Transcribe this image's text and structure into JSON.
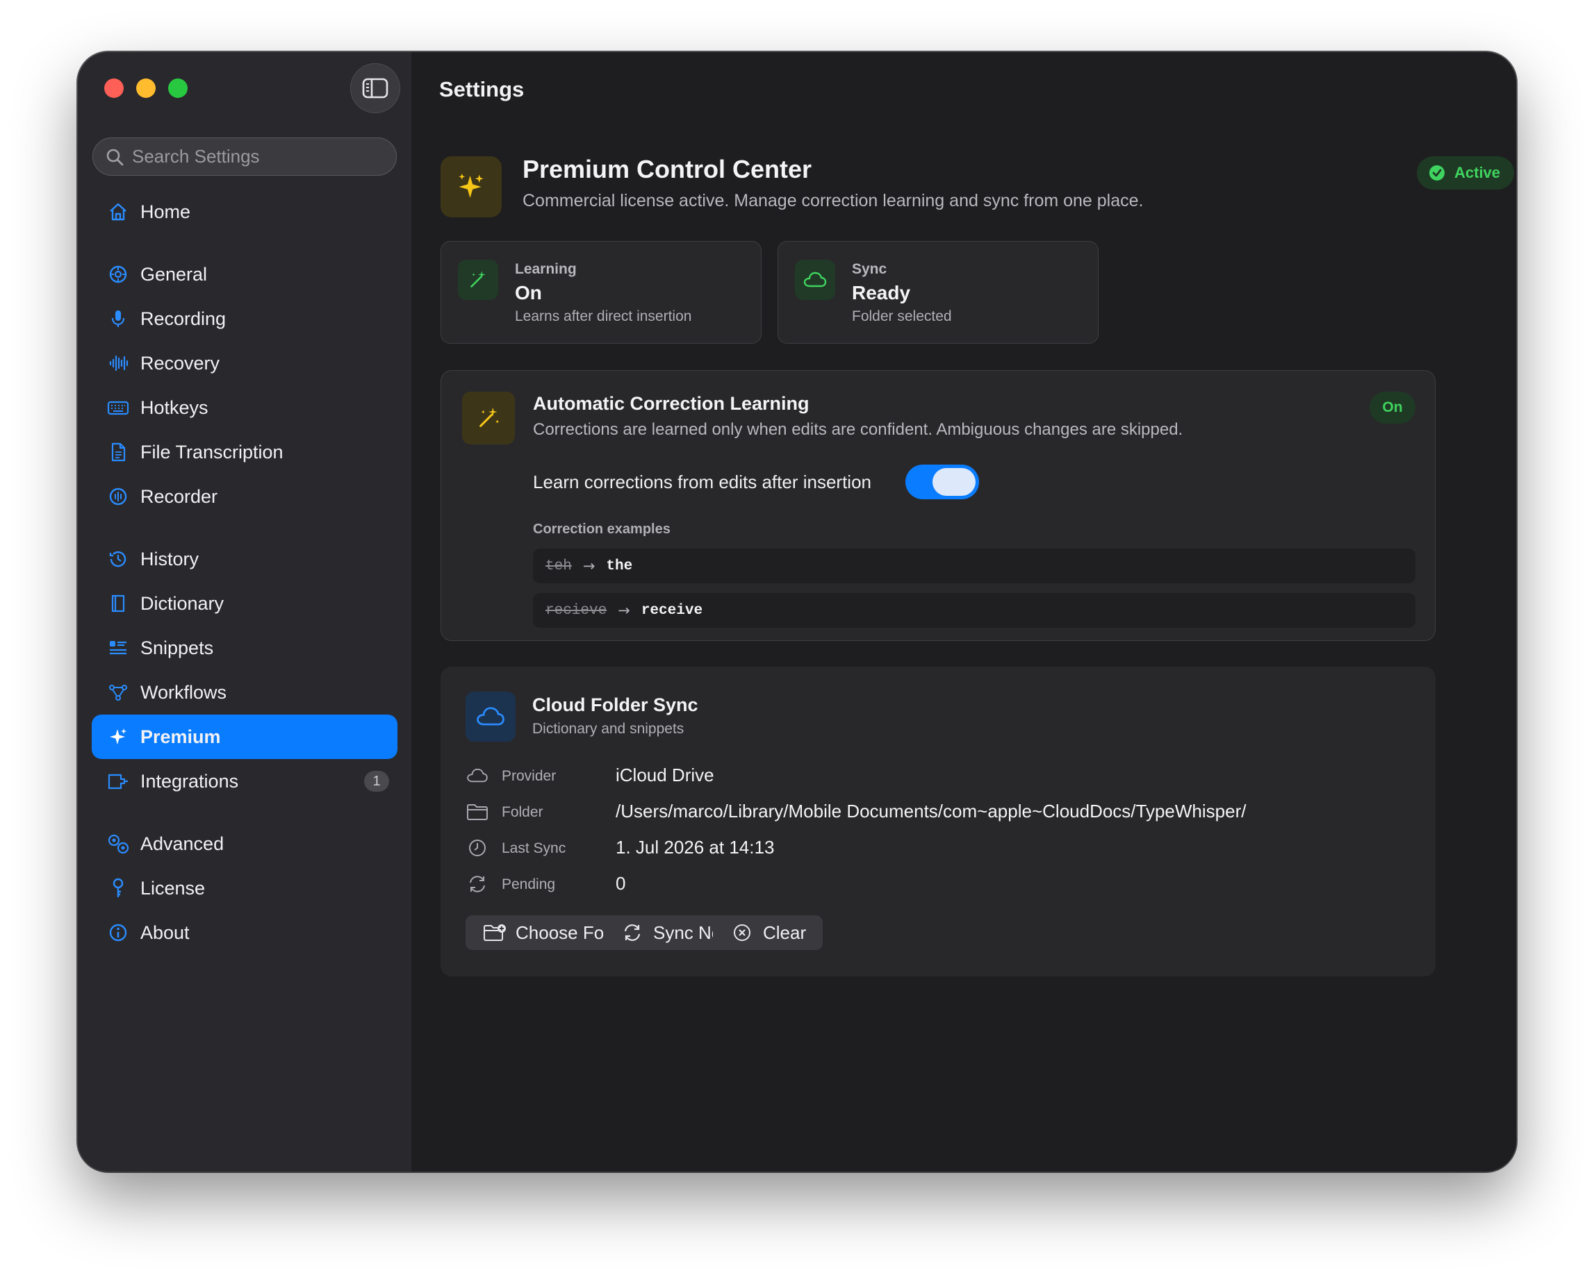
{
  "window": {
    "title": "Settings"
  },
  "sidebar": {
    "search_placeholder": "Search Settings",
    "items": [
      {
        "label": "Home",
        "icon": "house-icon"
      },
      {
        "label": "General",
        "icon": "gear-icon"
      },
      {
        "label": "Recording",
        "icon": "microphone-icon"
      },
      {
        "label": "Recovery",
        "icon": "waveform-icon"
      },
      {
        "label": "Hotkeys",
        "icon": "keyboard-icon"
      },
      {
        "label": "File Transcription",
        "icon": "document-icon"
      },
      {
        "label": "Recorder",
        "icon": "record-icon"
      },
      {
        "label": "History",
        "icon": "clock-icon"
      },
      {
        "label": "Dictionary",
        "icon": "book-icon"
      },
      {
        "label": "Snippets",
        "icon": "text-list-icon"
      },
      {
        "label": "Workflows",
        "icon": "flow-icon"
      },
      {
        "label": "Premium",
        "icon": "sparkles-icon",
        "active": true
      },
      {
        "label": "Integrations",
        "icon": "puzzle-icon",
        "badge": "1"
      },
      {
        "label": "Advanced",
        "icon": "gears-icon"
      },
      {
        "label": "License",
        "icon": "key-icon"
      },
      {
        "label": "About",
        "icon": "info-icon"
      }
    ]
  },
  "hero": {
    "title": "Premium Control Center",
    "subtitle": "Commercial license active. Manage correction learning and sync from one place.",
    "status": "Active"
  },
  "stats": [
    {
      "label": "Learning",
      "value": "On",
      "sub": "Learns after direct insertion",
      "icon": "magic-wand-icon"
    },
    {
      "label": "Sync",
      "value": "Ready",
      "sub": "Folder selected",
      "icon": "cloud-icon"
    }
  ],
  "learning": {
    "title": "Automatic Correction Learning",
    "description": "Corrections are learned only when edits are confident. Ambiguous changes are skipped.",
    "status": "On",
    "toggle_label": "Learn corrections from edits after insertion",
    "toggle_on": true,
    "examples_heading": "Correction examples",
    "examples": [
      {
        "from": "teh",
        "to": "the"
      },
      {
        "from": "recieve",
        "to": "receive"
      }
    ]
  },
  "sync": {
    "title": "Cloud Folder Sync",
    "subtitle": "Dictionary and snippets",
    "rows": [
      {
        "key": "Provider",
        "value": "iCloud Drive",
        "icon": "cloud-icon"
      },
      {
        "key": "Folder",
        "value": "/Users/marco/Library/Mobile Documents/com~apple~CloudDocs/TypeWhisper/",
        "icon": "folder-icon"
      },
      {
        "key": "Last Sync",
        "value": "1. Jul 2026 at 14:13",
        "icon": "clock-icon"
      },
      {
        "key": "Pending",
        "value": "0",
        "icon": "refresh-icon"
      }
    ],
    "buttons": {
      "choose_folder": "Choose Folder",
      "sync_now": "Sync Now",
      "clear": "Clear"
    }
  },
  "colors": {
    "accent": "#0a7cff",
    "success": "#3fd45f",
    "premium": "#f5c518",
    "sidebar_bg": "#29292d",
    "content_bg": "#1e1e20"
  }
}
